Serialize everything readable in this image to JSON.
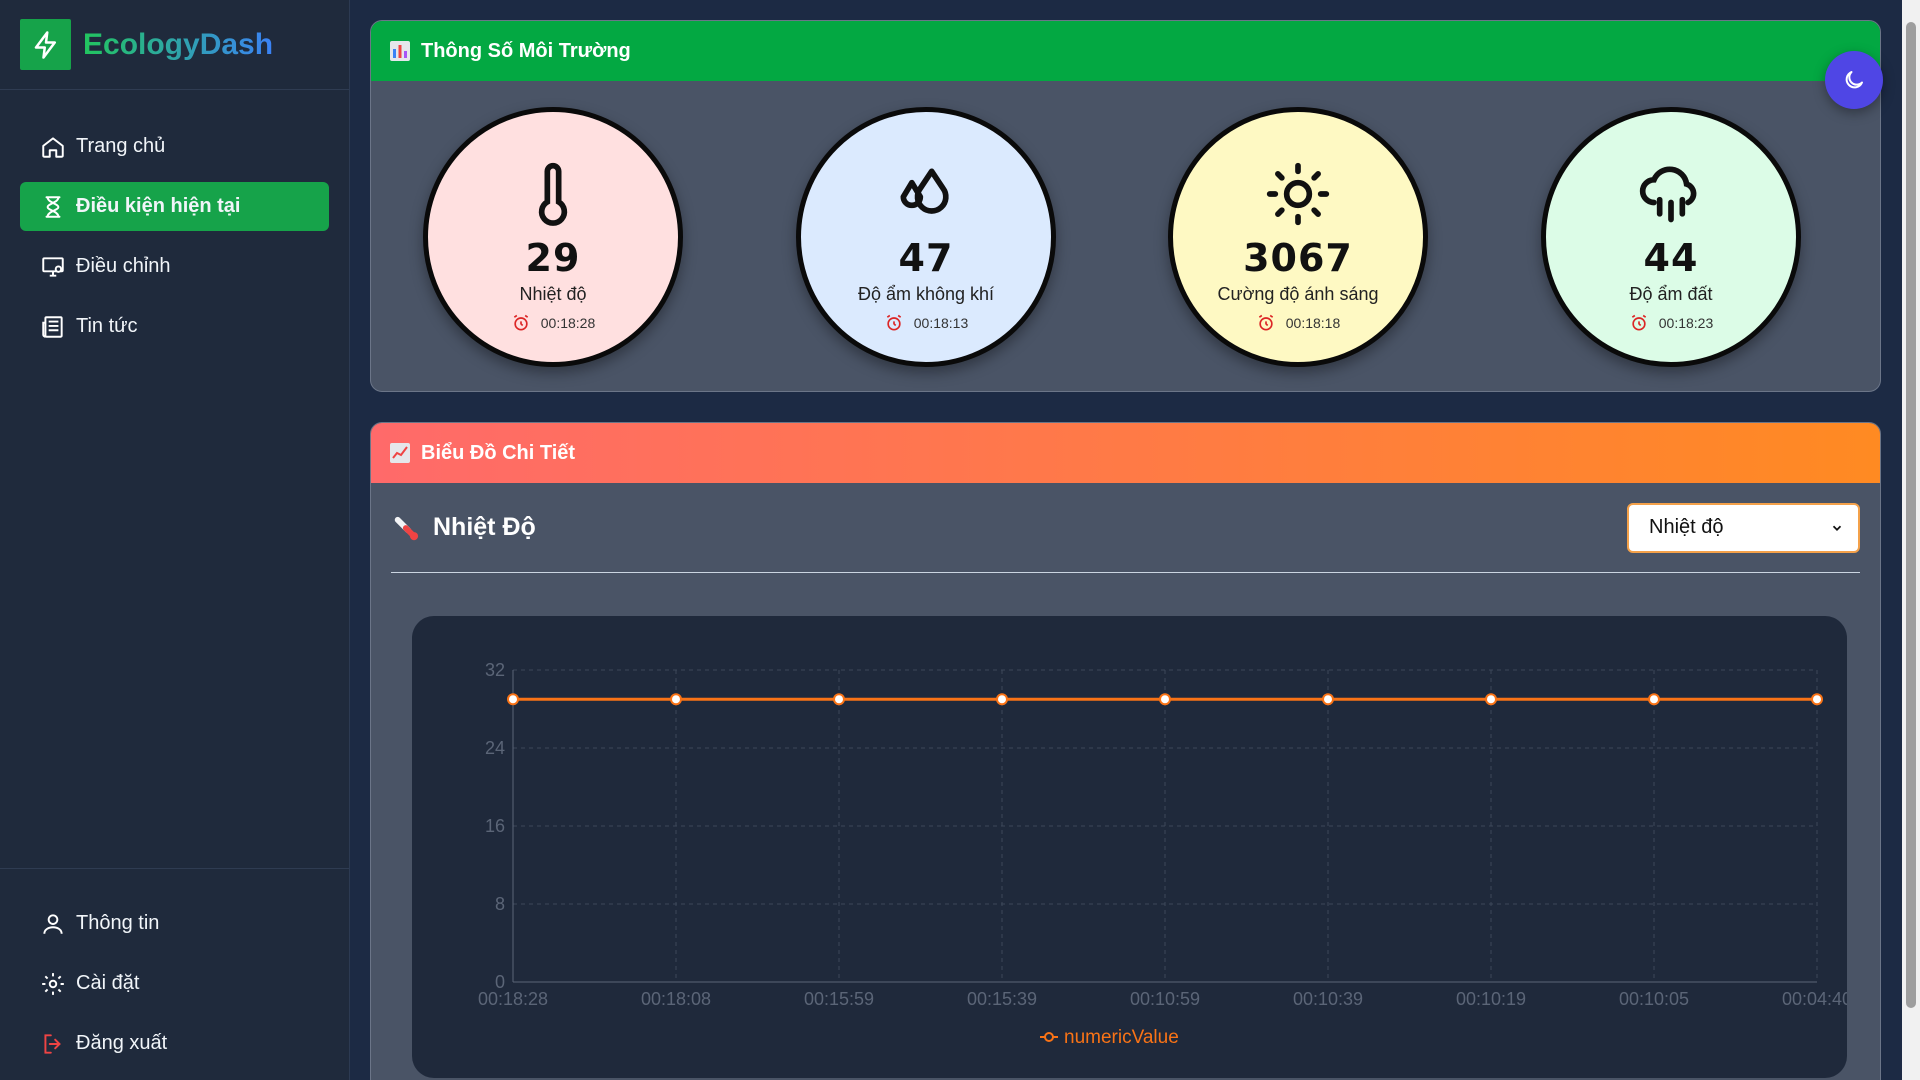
{
  "brand": {
    "name": "EcologyDash"
  },
  "nav": {
    "items": [
      {
        "label": "Trang chủ",
        "icon": "home-icon"
      },
      {
        "label": "Điều kiện hiện tại",
        "icon": "hourglass-icon",
        "active": true
      },
      {
        "label": "Điều chỉnh",
        "icon": "monitor-settings-icon"
      },
      {
        "label": "Tin tức",
        "icon": "newspaper-icon"
      }
    ],
    "bottom": [
      {
        "label": "Thông tin",
        "icon": "user-icon"
      },
      {
        "label": "Cài đặt",
        "icon": "gear-icon"
      },
      {
        "label": "Đăng xuất",
        "icon": "logout-icon"
      }
    ]
  },
  "environment": {
    "title": "Thông Số Môi Trường",
    "gauges": [
      {
        "value": "29",
        "label": "Nhiệt độ",
        "time": "00:18:28",
        "icon": "thermometer-icon",
        "bg": "#ffe0e0"
      },
      {
        "value": "47",
        "label": "Độ ẩm không khí",
        "time": "00:18:13",
        "icon": "droplets-icon",
        "bg": "#dbeafe"
      },
      {
        "value": "3067",
        "label": "Cường độ ánh sáng",
        "time": "00:18:18",
        "icon": "sun-icon",
        "bg": "#fef9c3"
      },
      {
        "value": "44",
        "label": "Độ ẩm đất",
        "time": "00:18:23",
        "icon": "cloud-rain-icon",
        "bg": "#dcfce7"
      }
    ]
  },
  "chart_panel": {
    "title": "Biểu Đồ Chi Tiết",
    "chart_title": "Nhiệt Độ",
    "select_value": "Nhiệt độ"
  },
  "colors": {
    "accent": "#16a34a",
    "line": "#f97316",
    "theme_button": "#4f46e5"
  },
  "chart_data": {
    "type": "line",
    "categories": [
      "00:18:28",
      "00:18:08",
      "00:15:59",
      "00:15:39",
      "00:10:59",
      "00:10:39",
      "00:10:19",
      "00:10:05",
      "00:04:40"
    ],
    "series": [
      {
        "name": "numericValue",
        "values": [
          29,
          29,
          29,
          29,
          29,
          29,
          29,
          29,
          29
        ]
      }
    ],
    "yticks": [
      0,
      8,
      16,
      24,
      32
    ],
    "ylim": [
      0,
      32
    ],
    "grid": true,
    "legend": "bottom"
  }
}
